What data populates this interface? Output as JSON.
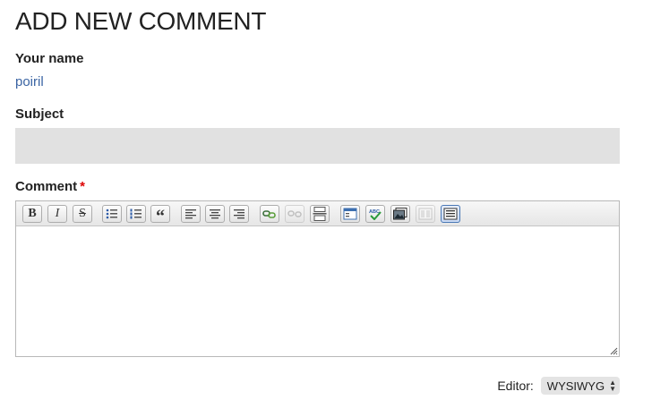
{
  "heading": "ADD NEW COMMENT",
  "name_field": {
    "label": "Your name",
    "value": "poiril"
  },
  "subject_field": {
    "label": "Subject",
    "value": ""
  },
  "comment_field": {
    "label": "Comment",
    "required_mark": "*"
  },
  "toolbar": {
    "bold": "B",
    "italic": "I",
    "strike": "S",
    "quote": "“",
    "buttons": [
      "bold",
      "italic",
      "strikethrough",
      "bullet-list",
      "numbered-list",
      "blockquote",
      "align-left",
      "align-center",
      "align-right",
      "insert-link",
      "unlink",
      "page-break",
      "source",
      "spellcheck",
      "insert-image",
      "templates",
      "show-blocks"
    ]
  },
  "editor_switch": {
    "label": "Editor:",
    "value": "WYSIWYG"
  },
  "colors": {
    "link": "#3a64a3",
    "required": "#dd0000",
    "input_bg": "#e1e1e1"
  }
}
